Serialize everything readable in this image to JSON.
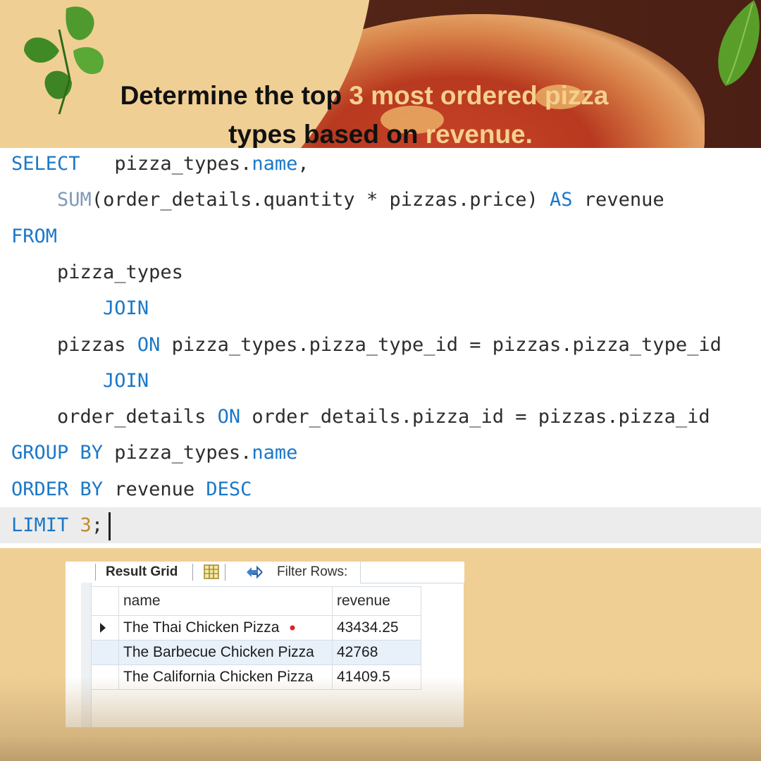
{
  "headline": {
    "line1_plain": "Determine the top ",
    "line1_highlight": "3 most ordered pizza",
    "line2_plain": "types based on ",
    "line2_highlight": "revenue."
  },
  "sql": {
    "lines": [
      [
        {
          "t": "SELECT",
          "c": "kw"
        },
        {
          "t": "   pizza_types.",
          "c": ""
        },
        {
          "t": "name",
          "c": "kw"
        },
        {
          "t": ",",
          "c": ""
        }
      ],
      [
        {
          "t": "    ",
          "c": ""
        },
        {
          "t": "SUM",
          "c": "fn"
        },
        {
          "t": "(order_details.quantity * pizzas.price) ",
          "c": ""
        },
        {
          "t": "AS",
          "c": "kw"
        },
        {
          "t": " revenue",
          "c": ""
        }
      ],
      [
        {
          "t": "FROM",
          "c": "kw"
        }
      ],
      [
        {
          "t": "    pizza_types",
          "c": ""
        }
      ],
      [
        {
          "t": "        ",
          "c": ""
        },
        {
          "t": "JOIN",
          "c": "kw"
        }
      ],
      [
        {
          "t": "    pizzas ",
          "c": ""
        },
        {
          "t": "ON",
          "c": "kw"
        },
        {
          "t": " pizza_types.pizza_type_id = pizzas.pizza_type_id",
          "c": ""
        }
      ],
      [
        {
          "t": "        ",
          "c": ""
        },
        {
          "t": "JOIN",
          "c": "kw"
        }
      ],
      [
        {
          "t": "    order_details ",
          "c": ""
        },
        {
          "t": "ON",
          "c": "kw"
        },
        {
          "t": " order_details.pizza_id = pizzas.pizza_id",
          "c": ""
        }
      ],
      [
        {
          "t": "GROUP BY",
          "c": "kw"
        },
        {
          "t": " pizza_types.",
          "c": ""
        },
        {
          "t": "name",
          "c": "kw"
        }
      ],
      [
        {
          "t": "ORDER BY",
          "c": "kw"
        },
        {
          "t": " revenue ",
          "c": ""
        },
        {
          "t": "DESC",
          "c": "kw"
        }
      ],
      [
        {
          "t": "LIMIT",
          "c": "kw"
        },
        {
          "t": " ",
          "c": ""
        },
        {
          "t": "3",
          "c": "num"
        },
        {
          "t": ";",
          "c": ""
        }
      ]
    ]
  },
  "result_grid": {
    "tab_label": "Result Grid",
    "filter_label": "Filter Rows:",
    "columns": [
      "name",
      "revenue"
    ],
    "rows": [
      {
        "name": "The Thai Chicken Pizza",
        "revenue": "43434.25"
      },
      {
        "name": "The Barbecue Chicken Pizza",
        "revenue": "42768"
      },
      {
        "name": "The California Chicken Pizza",
        "revenue": "41409.5"
      }
    ]
  },
  "colors": {
    "background": "#f0cf95",
    "keyword": "#1b78c8",
    "highlight_text": "#f5d08f",
    "banner_dark": "#4b1f14"
  }
}
